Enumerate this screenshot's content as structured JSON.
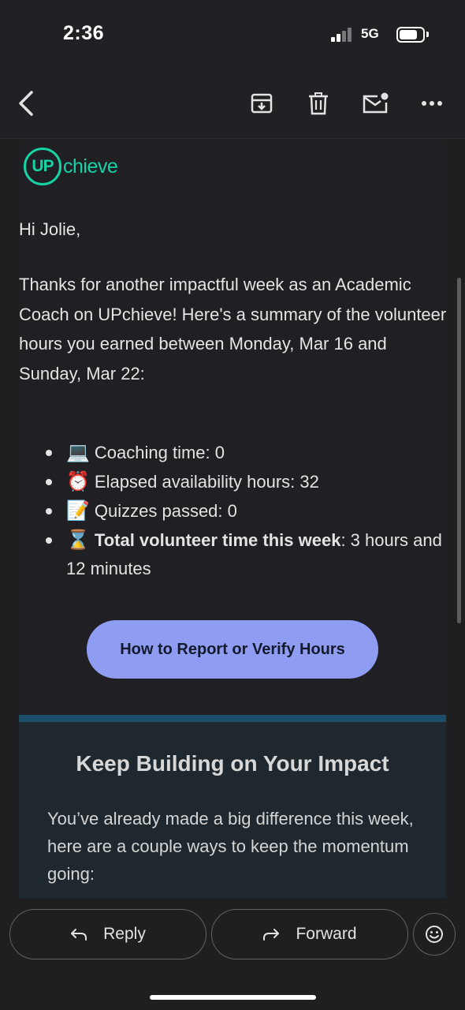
{
  "status_bar": {
    "time": "2:36",
    "network": "5G"
  },
  "toolbar": {
    "back_icon": "arrow-back-icon",
    "archive_icon": "archive-icon",
    "delete_icon": "trash-icon",
    "mark_unread_icon": "mark-unread-icon",
    "more_icon": "more-horizontal-icon"
  },
  "email": {
    "logo_mark": "UP",
    "logo_word": "chieve",
    "greeting": "Hi Jolie,",
    "intro": "Thanks for another impactful week as an Academic Coach on UPchieve! Here's a summary of the volunteer hours you earned between Monday, Mar 16 and Sunday, Mar 22:",
    "bullets": [
      {
        "emoji": "💻",
        "text": "Coaching time: 0"
      },
      {
        "emoji": "⏰",
        "text": "Elapsed availability hours: 32"
      },
      {
        "emoji": "📝",
        "text": "Quizzes passed: 0"
      },
      {
        "emoji": "⌛",
        "bold": "Total volunteer time this week",
        "text": ": 3 hours and 12 minutes"
      }
    ],
    "cta_label": "How to Report or Verify Hours",
    "section_title": "Keep Building on Your Impact",
    "section_text": "You’ve already made a big difference this week, here are a couple ways to keep the momentum going:"
  },
  "reply_bar": {
    "reply_label": "Reply",
    "forward_label": "Forward",
    "emoji_icon": "smiley-icon"
  },
  "colors": {
    "brand": "#16d2a5",
    "cta": "#8e9df2",
    "divider": "#1c4e6a"
  }
}
